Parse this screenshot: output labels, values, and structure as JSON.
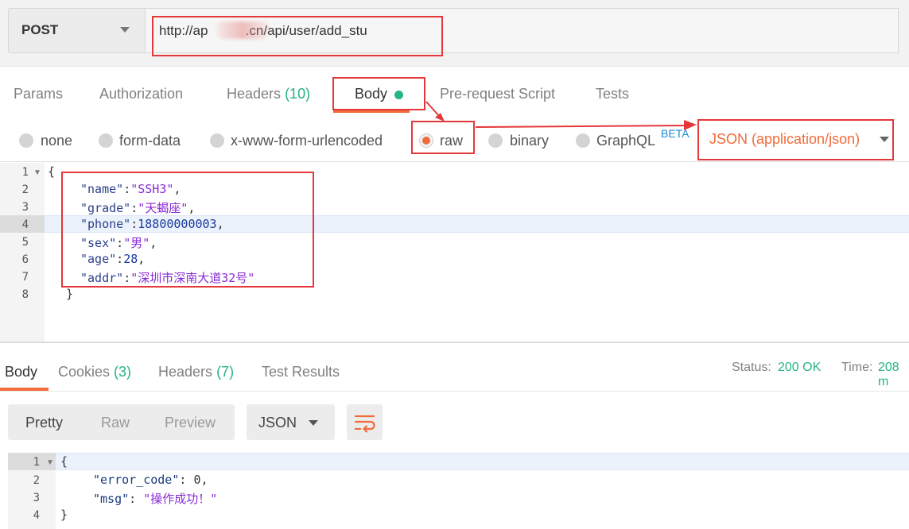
{
  "request": {
    "method": "POST",
    "url": "http://ap          .cn/api/user/add_stu"
  },
  "tabs": {
    "params": "Params",
    "authorization": "Authorization",
    "headers": "Headers",
    "headers_count": "(10)",
    "body": "Body",
    "pre_request": "Pre-request Script",
    "tests": "Tests"
  },
  "body_types": {
    "none": "none",
    "form_data": "form-data",
    "urlencoded": "x-www-form-urlencoded",
    "raw": "raw",
    "binary": "binary",
    "graphql": "GraphQL",
    "beta": "BETA",
    "selected": "raw",
    "content_type": "JSON (application/json)"
  },
  "editor": {
    "line_numbers": [
      "1",
      "2",
      "3",
      "4",
      "5",
      "6",
      "7",
      "8"
    ],
    "lines": {
      "l1": "{",
      "name_key": "\"name\"",
      "name_val": "\"SSH3\"",
      "grade_key": "\"grade\"",
      "grade_val": "\"天蝎座\"",
      "phone_key": "\"phone\"",
      "phone_val": "18800000003",
      "sex_key": "\"sex\"",
      "sex_val": "\"男\"",
      "age_key": "\"age\"",
      "age_val": "28",
      "addr_key": "\"addr\"",
      "addr_val": "\"深圳市深南大道32号\"",
      "l8": "}",
      "colon": ":",
      "comma": ","
    }
  },
  "response": {
    "tabs": {
      "body": "Body",
      "cookies": "Cookies",
      "cookies_count": "(3)",
      "headers": "Headers",
      "headers_count": "(7)",
      "test_results": "Test Results"
    },
    "status_label": "Status:",
    "status_value": "200 OK",
    "time_label": "Time:",
    "time_value": "208 m",
    "views": {
      "pretty": "Pretty",
      "raw": "Raw",
      "preview": "Preview"
    },
    "format": "JSON",
    "line_numbers": [
      "1",
      "2",
      "3",
      "4"
    ],
    "lines": {
      "l1": "{",
      "error_key": "\"error_code\"",
      "error_val": "0",
      "msg_key": "\"msg\"",
      "msg_val": "\"操作成功！\"",
      "l4": "}"
    }
  },
  "colors": {
    "accent": "#f26b3a",
    "success": "#26b47f",
    "annotation": "#e5383b",
    "beta": "#1a8bd6"
  }
}
